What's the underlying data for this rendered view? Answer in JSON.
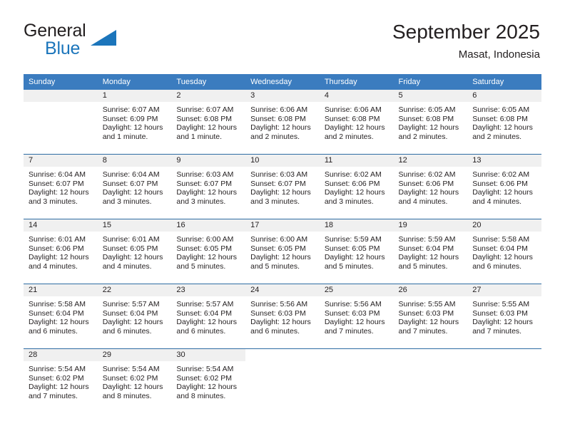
{
  "brand": {
    "name_part1": "General",
    "name_part2": "Blue",
    "triangle_color": "#1b75bb",
    "text_color": "#231f20"
  },
  "header": {
    "title": "September 2025",
    "subtitle": "Masat, Indonesia"
  },
  "colors": {
    "header_row_bg": "#3b7cbf",
    "header_row_text": "#ffffff",
    "date_band_bg": "#f0f0f0",
    "week_separator": "#2e6ca4",
    "body_text": "#231f20",
    "page_bg": "#ffffff"
  },
  "weekday_headers": [
    "Sunday",
    "Monday",
    "Tuesday",
    "Wednesday",
    "Thursday",
    "Friday",
    "Saturday"
  ],
  "labels": {
    "sunrise_prefix": "Sunrise:",
    "sunset_prefix": "Sunset:",
    "daylight_prefix": "Daylight:"
  },
  "weeks": [
    [
      {
        "day": "",
        "empty": true,
        "line1": "",
        "line2": "",
        "line3": "",
        "line4": ""
      },
      {
        "day": "1",
        "line1": "Sunrise: 6:07 AM",
        "line2": "Sunset: 6:09 PM",
        "line3": "Daylight: 12 hours",
        "line4": "and 1 minute."
      },
      {
        "day": "2",
        "line1": "Sunrise: 6:07 AM",
        "line2": "Sunset: 6:08 PM",
        "line3": "Daylight: 12 hours",
        "line4": "and 1 minute."
      },
      {
        "day": "3",
        "line1": "Sunrise: 6:06 AM",
        "line2": "Sunset: 6:08 PM",
        "line3": "Daylight: 12 hours",
        "line4": "and 2 minutes."
      },
      {
        "day": "4",
        "line1": "Sunrise: 6:06 AM",
        "line2": "Sunset: 6:08 PM",
        "line3": "Daylight: 12 hours",
        "line4": "and 2 minutes."
      },
      {
        "day": "5",
        "line1": "Sunrise: 6:05 AM",
        "line2": "Sunset: 6:08 PM",
        "line3": "Daylight: 12 hours",
        "line4": "and 2 minutes."
      },
      {
        "day": "6",
        "line1": "Sunrise: 6:05 AM",
        "line2": "Sunset: 6:08 PM",
        "line3": "Daylight: 12 hours",
        "line4": "and 2 minutes."
      }
    ],
    [
      {
        "day": "7",
        "line1": "Sunrise: 6:04 AM",
        "line2": "Sunset: 6:07 PM",
        "line3": "Daylight: 12 hours",
        "line4": "and 3 minutes."
      },
      {
        "day": "8",
        "line1": "Sunrise: 6:04 AM",
        "line2": "Sunset: 6:07 PM",
        "line3": "Daylight: 12 hours",
        "line4": "and 3 minutes."
      },
      {
        "day": "9",
        "line1": "Sunrise: 6:03 AM",
        "line2": "Sunset: 6:07 PM",
        "line3": "Daylight: 12 hours",
        "line4": "and 3 minutes."
      },
      {
        "day": "10",
        "line1": "Sunrise: 6:03 AM",
        "line2": "Sunset: 6:07 PM",
        "line3": "Daylight: 12 hours",
        "line4": "and 3 minutes."
      },
      {
        "day": "11",
        "line1": "Sunrise: 6:02 AM",
        "line2": "Sunset: 6:06 PM",
        "line3": "Daylight: 12 hours",
        "line4": "and 3 minutes."
      },
      {
        "day": "12",
        "line1": "Sunrise: 6:02 AM",
        "line2": "Sunset: 6:06 PM",
        "line3": "Daylight: 12 hours",
        "line4": "and 4 minutes."
      },
      {
        "day": "13",
        "line1": "Sunrise: 6:02 AM",
        "line2": "Sunset: 6:06 PM",
        "line3": "Daylight: 12 hours",
        "line4": "and 4 minutes."
      }
    ],
    [
      {
        "day": "14",
        "line1": "Sunrise: 6:01 AM",
        "line2": "Sunset: 6:06 PM",
        "line3": "Daylight: 12 hours",
        "line4": "and 4 minutes."
      },
      {
        "day": "15",
        "line1": "Sunrise: 6:01 AM",
        "line2": "Sunset: 6:05 PM",
        "line3": "Daylight: 12 hours",
        "line4": "and 4 minutes."
      },
      {
        "day": "16",
        "line1": "Sunrise: 6:00 AM",
        "line2": "Sunset: 6:05 PM",
        "line3": "Daylight: 12 hours",
        "line4": "and 5 minutes."
      },
      {
        "day": "17",
        "line1": "Sunrise: 6:00 AM",
        "line2": "Sunset: 6:05 PM",
        "line3": "Daylight: 12 hours",
        "line4": "and 5 minutes."
      },
      {
        "day": "18",
        "line1": "Sunrise: 5:59 AM",
        "line2": "Sunset: 6:05 PM",
        "line3": "Daylight: 12 hours",
        "line4": "and 5 minutes."
      },
      {
        "day": "19",
        "line1": "Sunrise: 5:59 AM",
        "line2": "Sunset: 6:04 PM",
        "line3": "Daylight: 12 hours",
        "line4": "and 5 minutes."
      },
      {
        "day": "20",
        "line1": "Sunrise: 5:58 AM",
        "line2": "Sunset: 6:04 PM",
        "line3": "Daylight: 12 hours",
        "line4": "and 6 minutes."
      }
    ],
    [
      {
        "day": "21",
        "line1": "Sunrise: 5:58 AM",
        "line2": "Sunset: 6:04 PM",
        "line3": "Daylight: 12 hours",
        "line4": "and 6 minutes."
      },
      {
        "day": "22",
        "line1": "Sunrise: 5:57 AM",
        "line2": "Sunset: 6:04 PM",
        "line3": "Daylight: 12 hours",
        "line4": "and 6 minutes."
      },
      {
        "day": "23",
        "line1": "Sunrise: 5:57 AM",
        "line2": "Sunset: 6:04 PM",
        "line3": "Daylight: 12 hours",
        "line4": "and 6 minutes."
      },
      {
        "day": "24",
        "line1": "Sunrise: 5:56 AM",
        "line2": "Sunset: 6:03 PM",
        "line3": "Daylight: 12 hours",
        "line4": "and 6 minutes."
      },
      {
        "day": "25",
        "line1": "Sunrise: 5:56 AM",
        "line2": "Sunset: 6:03 PM",
        "line3": "Daylight: 12 hours",
        "line4": "and 7 minutes."
      },
      {
        "day": "26",
        "line1": "Sunrise: 5:55 AM",
        "line2": "Sunset: 6:03 PM",
        "line3": "Daylight: 12 hours",
        "line4": "and 7 minutes."
      },
      {
        "day": "27",
        "line1": "Sunrise: 5:55 AM",
        "line2": "Sunset: 6:03 PM",
        "line3": "Daylight: 12 hours",
        "line4": "and 7 minutes."
      }
    ],
    [
      {
        "day": "28",
        "line1": "Sunrise: 5:54 AM",
        "line2": "Sunset: 6:02 PM",
        "line3": "Daylight: 12 hours",
        "line4": "and 7 minutes."
      },
      {
        "day": "29",
        "line1": "Sunrise: 5:54 AM",
        "line2": "Sunset: 6:02 PM",
        "line3": "Daylight: 12 hours",
        "line4": "and 8 minutes."
      },
      {
        "day": "30",
        "line1": "Sunrise: 5:54 AM",
        "line2": "Sunset: 6:02 PM",
        "line3": "Daylight: 12 hours",
        "line4": "and 8 minutes."
      },
      {
        "day": "",
        "blank": true,
        "line1": "",
        "line2": "",
        "line3": "",
        "line4": ""
      },
      {
        "day": "",
        "blank": true,
        "line1": "",
        "line2": "",
        "line3": "",
        "line4": ""
      },
      {
        "day": "",
        "blank": true,
        "line1": "",
        "line2": "",
        "line3": "",
        "line4": ""
      },
      {
        "day": "",
        "blank": true,
        "line1": "",
        "line2": "",
        "line3": "",
        "line4": ""
      }
    ]
  ]
}
